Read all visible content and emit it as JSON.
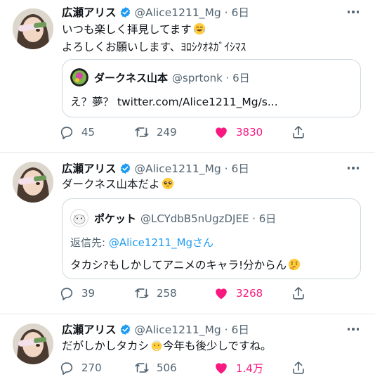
{
  "colors": {
    "accent": "#1d9bf0",
    "like": "#f91880",
    "muted": "#536471",
    "text": "#0f1419",
    "border": "#cfd9de"
  },
  "tweets": [
    {
      "name": "広瀬アリス",
      "meta": "@Alice1211_Mg · 6日",
      "lines": [
        "いつも楽しく拝見してます",
        "よろしくお願いします、ﾖﾛｼｸｵﾈｶﾞｲｼﾏｽ"
      ],
      "line1_emoji": "laughing-crying-emoji",
      "quote": {
        "name": "ダークネス山本",
        "meta": "@sprtonk · 6日",
        "text": "え？夢？ twitter.com/Alice1211_Mg/s..."
      },
      "replies": "45",
      "retweets": "249",
      "likes": "3830"
    },
    {
      "name": "広瀬アリス",
      "meta": "@Alice1211_Mg · 6日",
      "lines": [
        "ダークネス山本だよ"
      ],
      "line1_emoji": "pleading-face-emoji",
      "quote": {
        "name": "ポケット",
        "meta": "@LCYdbB5nUgzDJEE · 6日",
        "replying_prefix": "返信先: ",
        "replying_mention": "@Alice1211_Mg",
        "replying_suffix": "さん",
        "text": "タカシ?もしかしてアニメのキャラ!分からん"
      },
      "replies": "39",
      "retweets": "258",
      "likes": "3268"
    },
    {
      "name": "広瀬アリス",
      "meta": "@Alice1211_Mg · 6日",
      "lines": [
        "だがしかしタカシ",
        "今年も後少しですね。"
      ],
      "replies": "270",
      "retweets": "506",
      "likes": "1.4万"
    }
  ]
}
